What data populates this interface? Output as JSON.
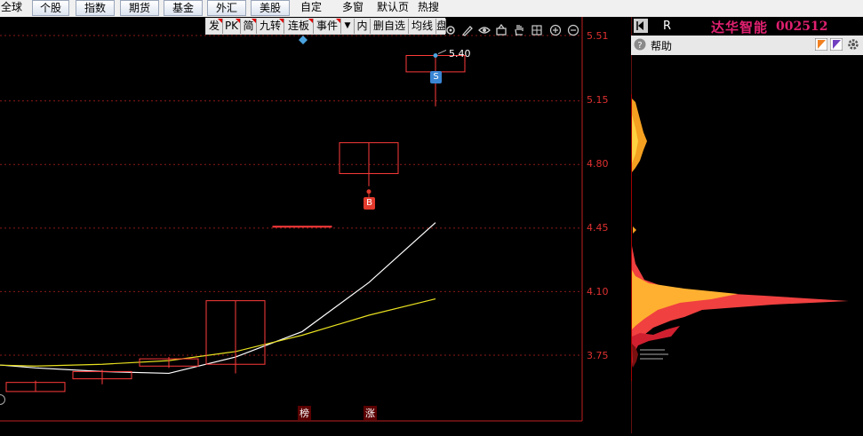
{
  "nav": {
    "items": [
      {
        "label": "全球",
        "style": "plain"
      },
      {
        "label": "个股",
        "style": "btn"
      },
      {
        "label": "指数",
        "style": "btn"
      },
      {
        "label": "期货",
        "style": "btn"
      },
      {
        "label": "基金",
        "style": "btn"
      },
      {
        "label": "外汇",
        "style": "btn"
      },
      {
        "label": "美股",
        "style": "btn"
      },
      {
        "label": "自定",
        "style": "plain"
      },
      {
        "label": "多窗",
        "style": "plain"
      },
      {
        "label": "默认页",
        "style": "plain"
      },
      {
        "label": "热搜",
        "style": "plain"
      }
    ]
  },
  "toolbar": {
    "items": [
      "发",
      "PK",
      "简",
      "九转",
      "连板",
      "事件",
      "▼",
      "内",
      "删自选",
      "均线",
      "盘后"
    ],
    "icons": [
      "settings-icon",
      "pen-icon",
      "eye-icon",
      "basket-icon",
      "hand-icon",
      "grid-icon",
      "zoom-in-icon",
      "zoom-out-icon"
    ]
  },
  "stock": {
    "name": "达华智能",
    "code": "002512",
    "r_label": "R",
    "help_label": "帮助",
    "colors": {
      "name": "#e02070",
      "accent": "#e03030"
    }
  },
  "chart_data": {
    "type": "candlestick",
    "y_ticks": [
      "5.51",
      "5.15",
      "4.80",
      "4.45",
      "4.10",
      "3.75"
    ],
    "candles": [
      {
        "open": 3.55,
        "close": 3.6,
        "high": 3.61,
        "low": 3.55
      },
      {
        "open": 3.62,
        "close": 3.66,
        "high": 3.67,
        "low": 3.59
      },
      {
        "open": 3.69,
        "close": 3.73,
        "high": 3.74,
        "low": 3.68
      },
      {
        "open": 3.7,
        "close": 4.05,
        "high": 4.05,
        "low": 3.65
      },
      {
        "open": 4.46,
        "close": 4.46,
        "high": 4.46,
        "low": 4.46
      },
      {
        "open": 4.75,
        "close": 4.92,
        "high": 4.92,
        "low": 4.68
      },
      {
        "open": 5.31,
        "close": 5.4,
        "high": 5.4,
        "low": 5.12
      }
    ],
    "ma_white": [
      3.71,
      3.68,
      3.66,
      3.65,
      3.74,
      3.88,
      4.15,
      4.48
    ],
    "ma_yellow": [
      3.71,
      3.7,
      3.69,
      3.7,
      3.72,
      3.77,
      3.86,
      3.97,
      4.06
    ],
    "markers": {
      "high_label": "5.40",
      "buy_label": "B",
      "sell_label": "S"
    },
    "bottom_tags": [
      "榜",
      "涨"
    ]
  }
}
